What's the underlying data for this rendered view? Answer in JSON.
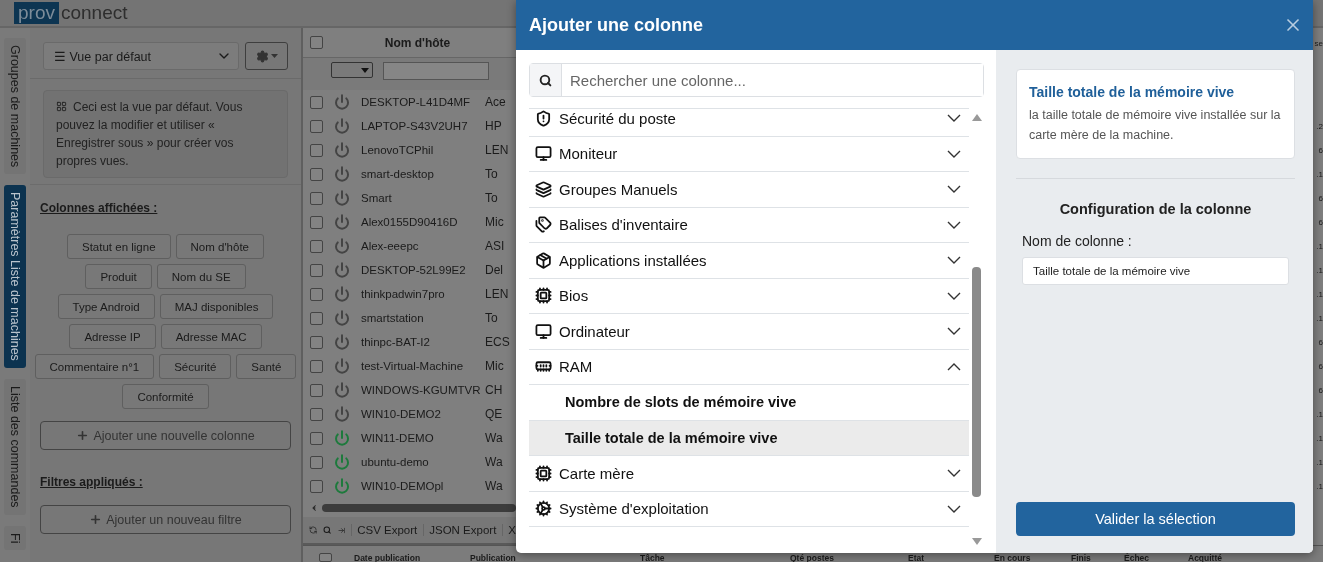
{
  "logo": {
    "part1": "prov",
    "part2": "connect"
  },
  "side_tabs": [
    {
      "label": "Groupes de machines",
      "selected": false
    },
    {
      "label": "Paramètres Liste de machines",
      "selected": true
    },
    {
      "label": "Liste des commandes",
      "selected": false
    },
    {
      "label": "Fi",
      "selected": false
    }
  ],
  "view_panel": {
    "view_select": "☰ Vue par défaut",
    "info": "Ceci est la vue par défaut. Vous pouvez la modifier et utiliser « Enregistrer sous » pour créer vos propres vues.",
    "columns_title": "Colonnes affichées :",
    "columns": [
      [
        "Statut en ligne",
        "Nom d'hôte"
      ],
      [
        "Produit",
        "Nom du SE"
      ],
      [
        "Type Android",
        "MAJ disponibles"
      ],
      [
        "Adresse IP",
        "Adresse MAC"
      ],
      [
        "Commentaire n°1",
        "Sécurité",
        "Santé"
      ],
      [
        "Conformité"
      ]
    ],
    "add_column": "Ajouter une nouvelle colonne",
    "filters_title": "Filtres appliqués :",
    "add_filter": "Ajouter un nouveau filtre"
  },
  "table": {
    "header": "Nom d'hôte",
    "header_checked": false,
    "right_header": "se",
    "rows": [
      {
        "checked": false,
        "host": "DESKTOP-L41D4MF",
        "online": false,
        "column_3": "Ace"
      },
      {
        "checked": false,
        "host": "LAPTOP-S43V2UH7",
        "online": false,
        "column_3": "HP",
        "column_far": ".2"
      },
      {
        "checked": false,
        "host": "LenovoTCPhil",
        "online": false,
        "column_3": "LEN",
        "column_far": "6"
      },
      {
        "checked": false,
        "host": "smart-desktop",
        "online": false,
        "column_3": "To",
        "column_far": ".1"
      },
      {
        "checked": false,
        "host": "Smart",
        "online": false,
        "column_3": "To",
        "column_far": "6"
      },
      {
        "checked": false,
        "host": "Alex0155D90416D",
        "online": false,
        "column_3": "Mic",
        "column_far": "6"
      },
      {
        "checked": false,
        "host": "Alex-eeepc",
        "online": false,
        "column_3": "ASI",
        "column_far": ".1"
      },
      {
        "checked": false,
        "host": "DESKTOP-52L99E2",
        "online": false,
        "column_3": "Del",
        "column_far": ".1"
      },
      {
        "checked": false,
        "host": "thinkpadwin7pro",
        "online": false,
        "column_3": "LEN",
        "column_far": ".1"
      },
      {
        "checked": false,
        "host": "smartstation",
        "online": false,
        "column_3": "To",
        "column_far": ".1"
      },
      {
        "checked": false,
        "host": "thinpc-BAT-I2",
        "online": false,
        "column_3": "ECS",
        "column_far": "6"
      },
      {
        "checked": false,
        "host": "test-Virtual-Machine",
        "online": false,
        "column_3": "Mic",
        "column_far": "6"
      },
      {
        "checked": false,
        "host": "WINDOWS-KGUMTVR",
        "online": false,
        "column_3": "CH",
        "column_far": "6"
      },
      {
        "checked": false,
        "host": "WIN10-DEMO2",
        "online": false,
        "column_3": "QE",
        "column_far": ".1"
      },
      {
        "checked": false,
        "host": "WIN11-DEMO",
        "online": true,
        "column_3": "Wa",
        "column_far": ".1"
      },
      {
        "checked": false,
        "host": "ubuntu-demo",
        "online": true,
        "column_3": "Wa",
        "column_far": ".1"
      },
      {
        "checked": false,
        "host": "WIN10-DEMOpl",
        "online": true,
        "column_3": "Wa",
        "column_far": ".1"
      }
    ],
    "toolbar": [
      "CSV Export",
      "JSON Export",
      "X"
    ]
  },
  "bottom_table": {
    "header_checked": false,
    "columns": [
      "Date publication",
      "Publication",
      "Tâche",
      "Qté postes",
      "Etat",
      "En cours",
      "Finis",
      "Échec",
      "Acquitté"
    ]
  },
  "dialog": {
    "title": "Ajouter une colonne",
    "search_placeholder": "Rechercher une colonne...",
    "groups": [
      {
        "label": "Sécurité du poste",
        "expanded": false
      },
      {
        "label": "Moniteur",
        "expanded": false
      },
      {
        "label": "Groupes Manuels",
        "expanded": false
      },
      {
        "label": "Balises d'inventaire",
        "expanded": false
      },
      {
        "label": "Applications installées",
        "expanded": false
      },
      {
        "label": "Bios",
        "expanded": false
      },
      {
        "label": "Ordinateur",
        "expanded": false
      },
      {
        "label": "RAM",
        "expanded": true,
        "children": [
          {
            "label": "Nombre de slots de mémoire vive",
            "selected": false
          },
          {
            "label": "Taille totale de la mémoire vive",
            "selected": true
          }
        ]
      },
      {
        "label": "Carte mère",
        "expanded": false
      },
      {
        "label": "Système d'exploitation",
        "expanded": false
      }
    ],
    "detail": {
      "title": "Taille totale de la mémoire vive",
      "description": "la taille totale de mémoire vive installée sur la carte mère de la machine."
    },
    "config_title": "Configuration de la colonne",
    "name_label": "Nom de colonne :",
    "name_value": "Taille totale de la mémoire vive",
    "submit": "Valider la sélection"
  }
}
